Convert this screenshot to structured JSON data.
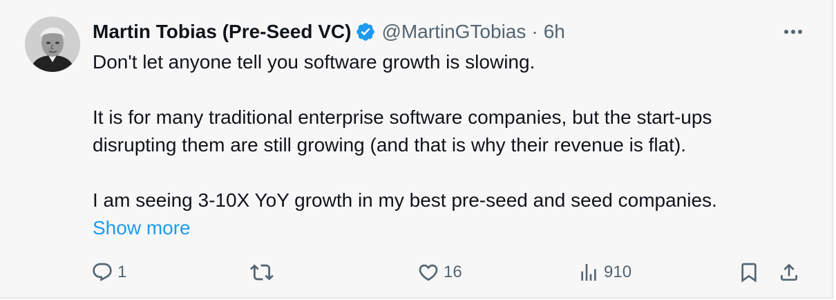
{
  "author": {
    "name": "Martin Tobias (Pre-Seed VC)",
    "handle": "@MartinGTobias",
    "separator": "·",
    "time": "6h",
    "verified_color": "#1d9bf0"
  },
  "tweet": {
    "lines": [
      "Don't let anyone tell you software growth is slowing.",
      "It is for many traditional enterprise software companies, but the start-ups",
      "disrupting them are still growing (and that is why their revenue is flat).",
      "I am seeing 3-10X YoY growth in my best pre-seed and seed companies."
    ],
    "show_more": "Show more"
  },
  "actions": {
    "reply_count": "1",
    "retweet_count": "",
    "like_count": "16",
    "views_count": "910"
  },
  "icons": {
    "more": "more-dots-icon",
    "reply": "reply-icon",
    "retweet": "retweet-icon",
    "like": "heart-icon",
    "views": "views-chart-icon",
    "bookmark": "bookmark-icon",
    "share": "share-icon"
  },
  "colors": {
    "accent": "#1d9bf0",
    "text": "#0f1419",
    "muted": "#536471",
    "background": "#f7f7f7"
  }
}
